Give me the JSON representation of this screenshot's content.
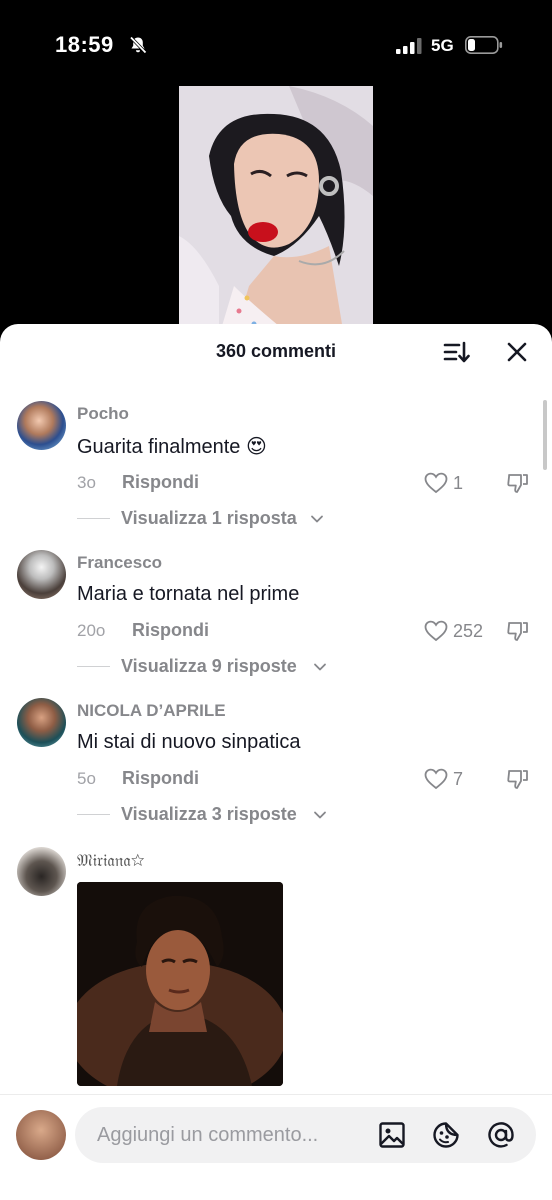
{
  "status": {
    "time": "18:59",
    "network": "5G"
  },
  "sheet": {
    "title": "360 commenti"
  },
  "comments": [
    {
      "user": "Pocho",
      "text": "Guarita finalmente 😍",
      "age": "3o",
      "reply": "Rispondi",
      "likes": "1",
      "view_replies": "Visualizza 1 risposta"
    },
    {
      "user": "Francesco",
      "text": "Maria e tornata nel prime",
      "age": "20o",
      "reply": "Rispondi",
      "likes": "252",
      "view_replies": "Visualizza 9 risposte"
    },
    {
      "user": "NICOLA D’APRILE",
      "text": "Mi stai di nuovo sinpatica",
      "age": "5o",
      "reply": "Rispondi",
      "likes": "7",
      "view_replies": "Visualizza 3 risposte"
    },
    {
      "user": "𝔐𝔦𝔯𝔦𝔞𝔫𝔞☆"
    }
  ],
  "composer": {
    "placeholder": "Aggiungi un commento..."
  },
  "icons": {
    "silent": "bell-slash-icon",
    "sort": "sort-icon",
    "close": "close-icon",
    "like": "heart-outline-icon",
    "dislike": "thumb-down-icon",
    "image": "image-icon",
    "sticker": "sticker-icon",
    "mention": "at-icon"
  },
  "colors": {
    "sheet_bg": "#ffffff",
    "muted_text": "#86878b",
    "body_text": "#161823",
    "input_bg": "#f1f1f2"
  }
}
